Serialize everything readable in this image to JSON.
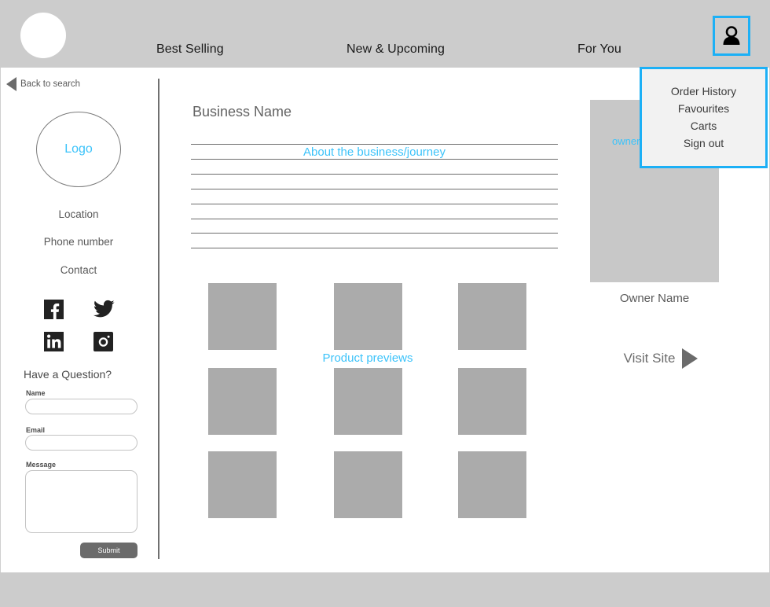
{
  "header": {
    "brand_logo_name": "brand-logo-circle",
    "nav": [
      {
        "label": "Best Selling"
      },
      {
        "label": "New & Upcoming"
      },
      {
        "label": "For You"
      }
    ],
    "account_icon": "person-icon",
    "accent_color": "#1cb0f6"
  },
  "account_menu": {
    "items": [
      {
        "label": "Order History"
      },
      {
        "label": "Favourites"
      },
      {
        "label": "Carts"
      },
      {
        "label": "Sign out"
      }
    ],
    "background": "#f2f2f2",
    "border_color": "#1cb0f6"
  },
  "back": {
    "label": "Back to search",
    "icon": "triangle-left-icon"
  },
  "sidebar": {
    "logo_text": "Logo",
    "location": "Location",
    "phone": "Phone number",
    "contact": "Contact",
    "social": [
      {
        "name": "facebook-icon"
      },
      {
        "name": "twitter-icon"
      },
      {
        "name": "linkedin-icon"
      },
      {
        "name": "instagram-icon"
      }
    ],
    "form": {
      "title": "Have a Question?",
      "name_label": "Name",
      "name_value": "",
      "email_label": "Email",
      "email_value": "",
      "message_label": "Message",
      "message_value": "",
      "submit_label": "Submit"
    }
  },
  "main": {
    "business_name": "Business Name",
    "about_label": "About the business/journey",
    "about_line_count": 8,
    "previews_label": "Product previews",
    "product_tile_count": 9,
    "product_tile_color": "#ababab"
  },
  "owner": {
    "image_label": "owner",
    "name": "Owner Name",
    "visit_label": "Visit Site",
    "visit_icon": "triangle-right-icon",
    "image_color": "#c8c8c8"
  }
}
